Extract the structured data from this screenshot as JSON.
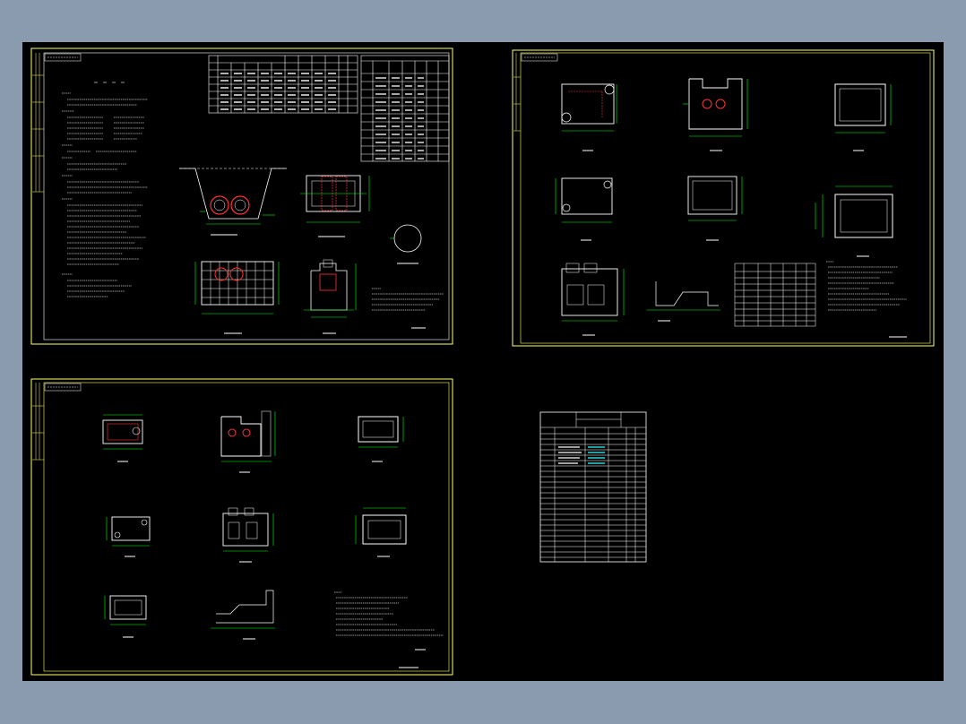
{
  "colors": {
    "frame": "#ffff66",
    "line": "#ffffff",
    "dim": "#00ff00",
    "accent": "#ff3333",
    "cyan": "#33ffff",
    "pale_text": "#c8c8c8"
  },
  "sheets": [
    {
      "id": "sheet-1"
    },
    {
      "id": "sheet-2"
    },
    {
      "id": "sheet-3"
    },
    {
      "id": "sheet-4"
    }
  ]
}
